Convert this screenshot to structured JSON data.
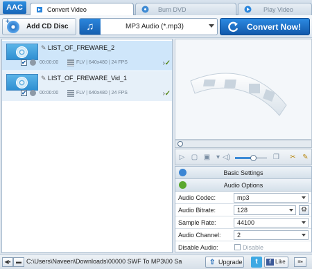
{
  "app": {
    "logo_text": "AAC"
  },
  "tabs": [
    {
      "label": "Convert Video",
      "active": true
    },
    {
      "label": "Burn DVD",
      "active": false
    },
    {
      "label": "Play Video",
      "active": false
    }
  ],
  "toolbar": {
    "add_cd_label": "Add CD Disc",
    "profile_value": "MP3 Audio (*.mp3)",
    "convert_label": "Convert Now!"
  },
  "files": [
    {
      "name": "LIST_OF_FREWARE_2",
      "duration": "00:00:00",
      "meta": "FLV | 640x480 | 24 FPS",
      "selected": true
    },
    {
      "name": "LIST_OF_FREWARE_Vid_1",
      "duration": "00:00:00",
      "meta": "FLV | 640x480 | 24 FPS",
      "selected": false
    }
  ],
  "settings": {
    "basic_label": "Basic Settings",
    "audio_label": "Audio Options",
    "rows": [
      {
        "label": "Audio Codec:",
        "value": "mp3"
      },
      {
        "label": "Audio Bitrate:",
        "value": "128"
      },
      {
        "label": "Sample Rate:",
        "value": "44100"
      },
      {
        "label": "Audio Channel:",
        "value": "2"
      },
      {
        "label": "Disable Audio:",
        "value": "Disable"
      }
    ]
  },
  "status": {
    "path": "C:\\Users\\Naveen\\Downloads\\00000 SWF To MP3\\00 Sa",
    "upgrade_label": "Upgrade",
    "like_label": "Like"
  },
  "colors": {
    "accent": "#1f6fc4",
    "selected_row": "#cfe6fa"
  }
}
